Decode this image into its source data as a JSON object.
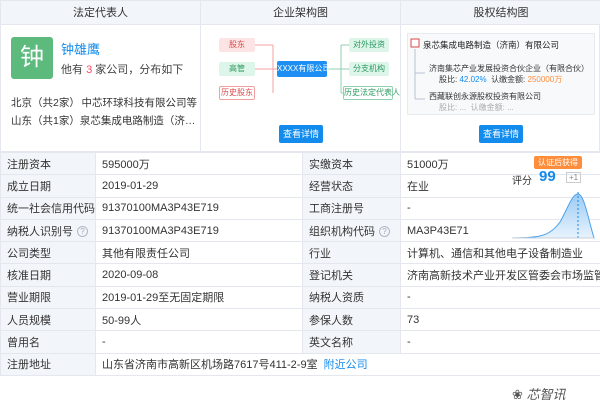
{
  "panels": {
    "legal_rep": {
      "title": "法定代表人",
      "avatar_char": "钟",
      "name": "钟雄鹰",
      "desc_prefix": "他有",
      "desc_count": "3",
      "desc_suffix": "家公司，分布如下",
      "companies": [
        {
          "region": "北京（共2家）",
          "name": "中芯环球科技有限公司等"
        },
        {
          "region": "山东（共1家）",
          "name": "泉芯集成电路制造（济...等"
        }
      ]
    },
    "org": {
      "title": "企业架构图",
      "nodes": {
        "shareholder": "股东",
        "executive": "高管",
        "history_shareholder": "历史股东",
        "center": "XXXX有限公司",
        "investment": "对外投资",
        "branch": "分支机构",
        "history_rep": "历史法定代表人"
      },
      "button": "查看详情"
    },
    "equity": {
      "title": "股权结构图",
      "top_company": "泉芯集成电路制造（济南）有限公司",
      "holder1_name": "济南集芯产业发展投资合伙企业（有限合伙）",
      "holder1_ratio_label": "股比:",
      "holder1_ratio": "42.02%",
      "holder1_amount_label": "认缴金额:",
      "holder1_amount": "250000万",
      "holder2_name": "西藏联创永源股权投资有限公司",
      "holder2_ratio_label": "股比:",
      "holder2_ratio": "...",
      "holder2_amount_label": "认缴金额:",
      "holder2_amount": "...",
      "button": "查看详情"
    }
  },
  "score": {
    "badge": "认证后获得",
    "label": "评分",
    "value": "99",
    "plus": "+1"
  },
  "rows": [
    {
      "l1": "注册资本",
      "v1": "595000万",
      "l2": "实缴资本",
      "v2": "51000万"
    },
    {
      "l1": "成立日期",
      "v1": "2019-01-29",
      "l2": "经营状态",
      "v2": "在业"
    },
    {
      "l1": "统一社会信用代码",
      "v1": "91370100MA3P43E719",
      "l2": "工商注册号",
      "v2": "-"
    },
    {
      "l1": "纳税人识别号",
      "v1": "91370100MA3P43E719",
      "l2": "组织机构代码",
      "v2": "MA3P43E71"
    },
    {
      "l1": "公司类型",
      "v1": "其他有限责任公司",
      "l2": "行业",
      "v2": "计算机、通信和其他电子设备制造业"
    },
    {
      "l1": "核准日期",
      "v1": "2020-09-08",
      "l2": "登记机关",
      "v2": "济南高新技术产业开发区管委会市场监管局"
    },
    {
      "l1": "营业期限",
      "v1": "2019-01-29至无固定期限",
      "l2": "纳税人资质",
      "v2": "-"
    },
    {
      "l1": "人员规模",
      "v1": "50-99人",
      "l2": "参保人数",
      "v2": "73"
    },
    {
      "l1": "曾用名",
      "v1": "-",
      "l2": "英文名称",
      "v2": "-"
    },
    {
      "l1": "注册地址",
      "v1": "山东省济南市高新区机场路7617号411-2-9室",
      "link": "附近公司"
    }
  ],
  "watermark": "芯智讯",
  "icons": {
    "help": "help-circle-icon",
    "wechat": "wechat-icon"
  }
}
